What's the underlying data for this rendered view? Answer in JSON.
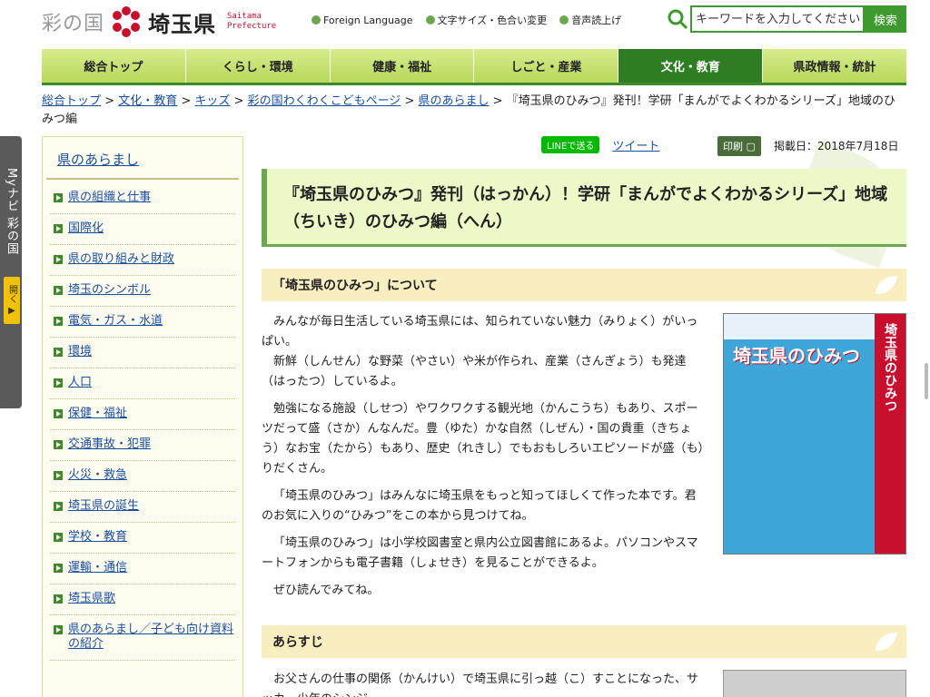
{
  "header": {
    "logo_sainokuni": "彩の国",
    "logo_saitama": "埼玉県",
    "logo_en_1": "Saitama",
    "logo_en_2": "Prefecture",
    "util_foreign": "Foreign Language",
    "util_fontsize": "文字サイズ・色合い変更",
    "util_voice": "音声読上げ",
    "search_placeholder": "キーワードを入力してください",
    "search_button": "検索"
  },
  "nav": {
    "items": [
      "総合トップ",
      "くらし・環境",
      "健康・福祉",
      "しごと・産業",
      "文化・教育",
      "県政情報・統計"
    ],
    "active_index": 4
  },
  "sidetab": {
    "label": "Myナビ 彩の国",
    "open": "開く ▶"
  },
  "breadcrumb": {
    "links": [
      "総合トップ",
      "文化・教育",
      "キッズ",
      "彩の国わくわくこどもページ",
      "県のあらまし"
    ],
    "current": "『埼玉県のひみつ』発刊！学研「まんがでよくわかるシリーズ」地域のひみつ編"
  },
  "sidebar": {
    "title": "県のあらまし",
    "items": [
      "県の組織と仕事",
      "国際化",
      "県の取り組みと財政",
      "埼玉のシンボル",
      "電気・ガス・水道",
      "環境",
      "人口",
      "保健・福祉",
      "交通事故・犯罪",
      "火災・救急",
      "埼玉県の誕生",
      "学校・教育",
      "運輸・通信",
      "埼玉県歌",
      "県のあらまし／子ども向け資料の紹介"
    ]
  },
  "share": {
    "line": "LINEで送る",
    "tweet": "ツイート",
    "print": "印刷",
    "pubdate": "掲載日：2018年7月18日"
  },
  "main": {
    "title": "『埼玉県のひみつ』発刊（はっかん）！学研「まんがでよくわかるシリーズ」地域（ちいき）のひみつ編（へん）",
    "section1_heading": "「埼玉県のひみつ」について",
    "paragraphs": [
      "みんなが毎日生活している埼玉県には、知られていない魅力（みりょく）がいっぱい。",
      "新鮮（しんせん）な野菜（やさい）や米が作られ、産業（さんぎょう）も発達（はったつ）しているよ。",
      "勉強になる施設（しせつ）やワクワクする観光地（かんこうち）もあり、スポーツだって盛（さか）んなんだ。豊（ゆた）かな自然（しぜん）・国の貴重（きちょう）なお宝（たから）もあり、歴史（れきし）でもおもしろいエピソードが盛（も）りだくさん。",
      "「埼玉県のひみつ」はみんなに埼玉県をもっと知ってほしくて作った本です。君のお気に入りの“ひみつ”をこの本から見つけてね。",
      "「埼玉県のひみつ」は小学校図書室と県内公立図書館にあるよ。パソコンやスマートフォンからも電子書籍（しょせき）を見ることができるよ。",
      "ぜひ読んでみてね。"
    ],
    "section2_heading": "あらすじ",
    "synopsis": "お父さんの仕事の関係（かんけい）で埼玉県に引っ越（こ）すことになった、サッカー少年のシンジ。"
  },
  "book": {
    "title": "埼玉県のひみつ",
    "spine": "埼玉県のひみつ"
  },
  "colors": {
    "brand_green": "#3e9a2e",
    "nav_active": "#2f7d23",
    "heading_bg": "#f9eec0",
    "title_bg": "#edf8c8"
  }
}
